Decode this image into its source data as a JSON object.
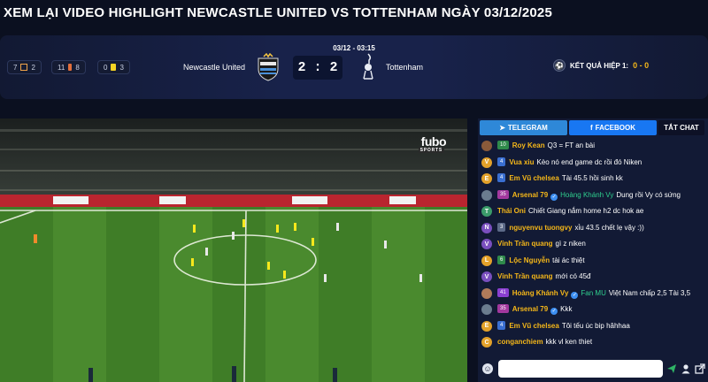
{
  "page": {
    "title": "XEM LẠI VIDEO HIGHLIGHT NEWCASTLE UNITED VS TOTTENHAM NGÀY 03/12/2025"
  },
  "scoreboard": {
    "stats": [
      {
        "count_home": "7",
        "icon": "corner-icon",
        "count_away": "2"
      },
      {
        "count_home": "11",
        "icon": "substitution-icon",
        "count_away": "8"
      },
      {
        "count_home": "0",
        "icon": "yellow-card-icon",
        "count_away": "3"
      }
    ],
    "match_time": "03/12 - 03:15",
    "home_team": "Newcastle United",
    "away_team": "Tottenham",
    "home_score": "2",
    "away_score": "2",
    "half_result_label": "KẾT QUẢ HIỆP 1:",
    "half_result_value": "0 - 0",
    "colors": {
      "accent": "#f5b719",
      "score_bg": "#0c1430"
    }
  },
  "video": {
    "broadcaster": "fubo",
    "broadcaster_sub": "SPORTS"
  },
  "chat": {
    "tabs": {
      "telegram": "TELEGRAM",
      "facebook": "FACEBOOK",
      "off": "TẮT CHAT"
    },
    "messages": [
      {
        "avatar": "",
        "avatar_color": "#8a5a3a",
        "level": "10",
        "level_color": "#2f8a4b",
        "user": "Roy Kean",
        "user_color": "#f5b719",
        "verified": false,
        "mention": "",
        "text": "Q3 = FT an bài"
      },
      {
        "avatar": "V",
        "avatar_color": "#e3a12a",
        "level": "4",
        "level_color": "#3a6fd1",
        "user": "Vua xiu",
        "user_color": "#f5b719",
        "verified": false,
        "mention": "",
        "text": "Kèo nó end game dc rồi đó Niken"
      },
      {
        "avatar": "E",
        "avatar_color": "#e3a12a",
        "level": "4",
        "level_color": "#3a6fd1",
        "user": "Em Vũ chelsea",
        "user_color": "#f5b719",
        "verified": false,
        "mention": "",
        "text": "Tài 45.5 hồi sinh kk"
      },
      {
        "avatar": "",
        "avatar_color": "#6b7c8f",
        "level": "35",
        "level_color": "#a2389e",
        "user": "Arsenal 79",
        "user_color": "#f5b719",
        "verified": true,
        "mention": "Hoàng Khánh Vy",
        "text": "Dung rồi Vy có sứng"
      },
      {
        "avatar": "T",
        "avatar_color": "#3b9b6a",
        "level": "",
        "level_color": "",
        "user": "Thái Oni",
        "user_color": "#f5b719",
        "verified": false,
        "mention": "",
        "text": "Chiết Giang nắm home h2 dc hok ae"
      },
      {
        "avatar": "N",
        "avatar_color": "#7a4fbf",
        "level": "3",
        "level_color": "#5c6a88",
        "user": "nguyenvu tuongvy",
        "user_color": "#f5b719",
        "verified": false,
        "mention": "",
        "text": "xỉu 43.5 chết lẹ vậy :))"
      },
      {
        "avatar": "V",
        "avatar_color": "#7a4fbf",
        "level": "",
        "level_color": "",
        "user": "Vinh Trần quang",
        "user_color": "#f5b719",
        "verified": false,
        "mention": "",
        "text": "gì z niken"
      },
      {
        "avatar": "L",
        "avatar_color": "#e3a12a",
        "level": "6",
        "level_color": "#2f8a4b",
        "user": "Lộc Nguyễn",
        "user_color": "#f5b719",
        "verified": false,
        "mention": "",
        "text": "tài ác thiệt"
      },
      {
        "avatar": "V",
        "avatar_color": "#7a4fbf",
        "level": "",
        "level_color": "",
        "user": "Vinh Trần quang",
        "user_color": "#f5b719",
        "verified": false,
        "mention": "",
        "text": "mới có 45đ"
      },
      {
        "avatar": "",
        "avatar_color": "#b07a5a",
        "level": "41",
        "level_color": "#8a3fd0",
        "user": "Hoàng Khánh Vy",
        "user_color": "#f5b719",
        "verified": true,
        "mention": "Fan MU",
        "text": "Việt Nam chấp 2,5 Tài 3,5"
      },
      {
        "avatar": "",
        "avatar_color": "#6b7c8f",
        "level": "35",
        "level_color": "#a2389e",
        "user": "Arsenal 79",
        "user_color": "#f5b719",
        "verified": true,
        "mention": "",
        "text": "Kkk"
      },
      {
        "avatar": "E",
        "avatar_color": "#e3a12a",
        "level": "4",
        "level_color": "#3a6fd1",
        "user": "Em Vũ chelsea",
        "user_color": "#f5b719",
        "verified": false,
        "mention": "",
        "text": "Tôi tếu úc bip hâhhaa"
      },
      {
        "avatar": "C",
        "avatar_color": "#e3a12a",
        "level": "",
        "level_color": "",
        "user": "conganchiem",
        "user_color": "#f5b719",
        "verified": false,
        "mention": "",
        "text": "kkk vl ken thiet"
      }
    ],
    "input_placeholder": ""
  }
}
